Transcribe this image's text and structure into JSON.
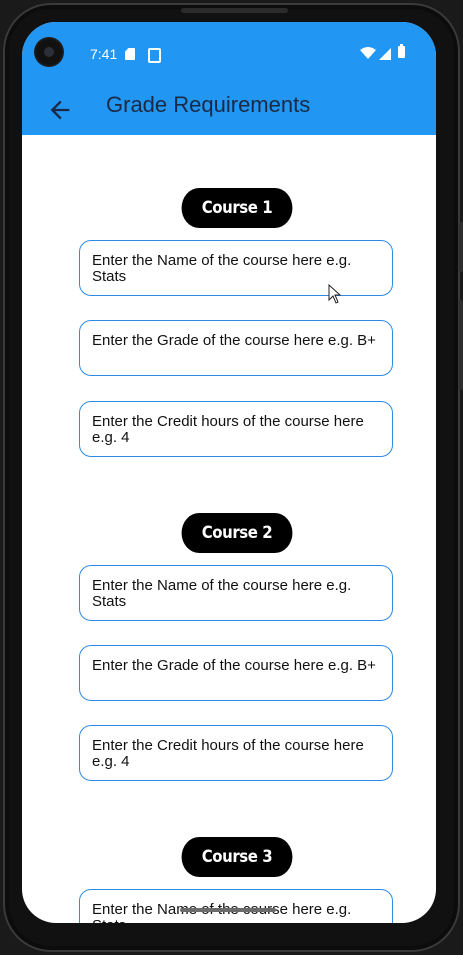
{
  "status_bar": {
    "time": "7:41",
    "icons": [
      "sd-card-icon",
      "screenshot-icon",
      "wifi-icon",
      "signal-icon",
      "battery-icon"
    ]
  },
  "app_bar": {
    "title": "Grade Requirements",
    "back_icon": "arrow-back-icon",
    "color": "#2196f3"
  },
  "courses": [
    {
      "label": "Course 1",
      "name_placeholder": "Enter the Name of the course here e.g. Stats",
      "grade_placeholder": "Enter the Grade of the course here e.g. B+",
      "credit_placeholder": "Enter the Credit hours of the course here e.g. 4"
    },
    {
      "label": "Course 2",
      "name_placeholder": "Enter the Name of the course here e.g. Stats",
      "grade_placeholder": "Enter the Grade of the course here e.g. B+",
      "credit_placeholder": "Enter the Credit hours of the course here e.g. 4"
    },
    {
      "label": "Course 3",
      "name_placeholder": "Enter the Name of the course here e.g. Stats"
    }
  ],
  "colors": {
    "accent": "#2196f3",
    "field_border": "#2e8be6",
    "pill": "#000000"
  }
}
